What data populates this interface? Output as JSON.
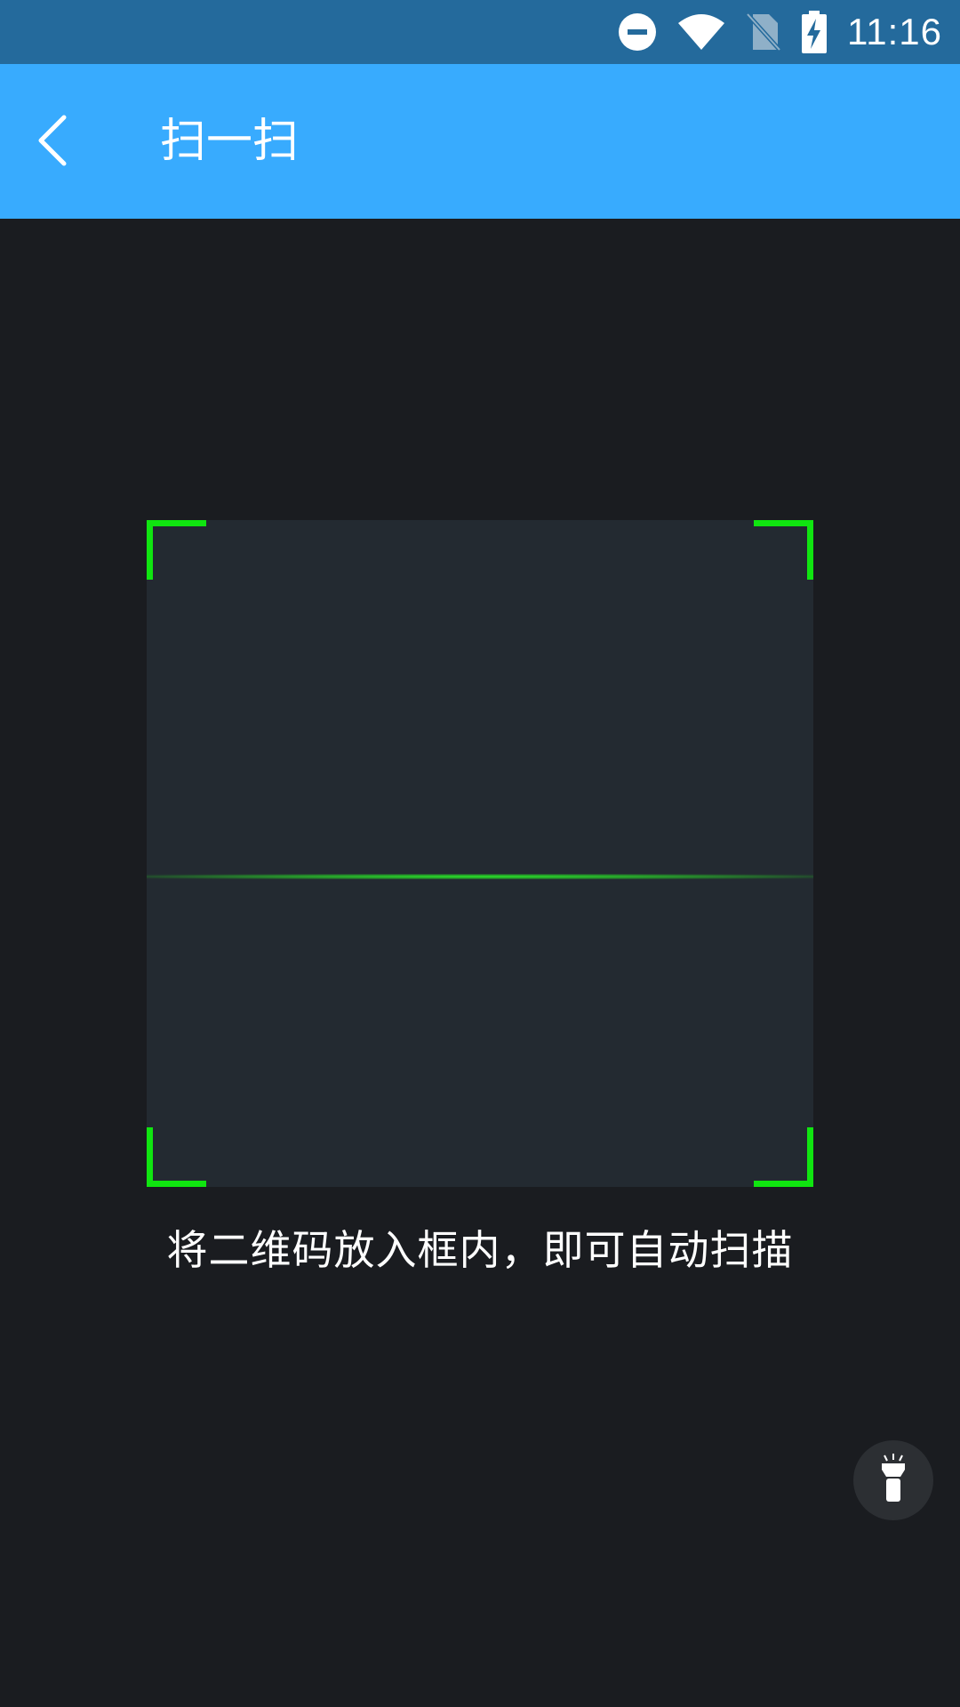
{
  "status_bar": {
    "time": "11:16",
    "icons": [
      "do-not-disturb-icon",
      "wifi-icon",
      "no-sim-icon",
      "battery-charging-icon"
    ]
  },
  "app_bar": {
    "title": "扫一扫",
    "back_icon": "chevron-left-icon"
  },
  "scanner": {
    "hint": "将二维码放入框内，即可自动扫描",
    "accent_color": "#10e510",
    "flashlight_icon": "flashlight-icon"
  },
  "colors": {
    "status_bar": "#246a9c",
    "app_bar": "#38abfe",
    "background": "#1a1c20",
    "frame": "#232a31"
  }
}
